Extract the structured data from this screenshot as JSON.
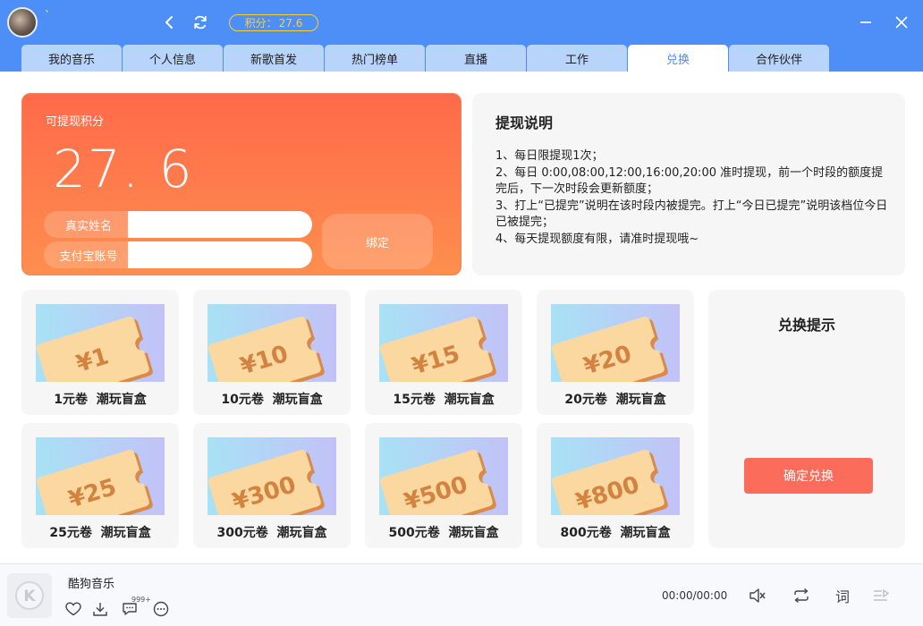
{
  "header": {
    "username": "`",
    "points_label": "积分：",
    "points_value": "27.6",
    "icons": [
      "back-icon",
      "refresh-icon",
      "minimize-icon",
      "close-icon"
    ]
  },
  "tabs": [
    {
      "label": "我的音乐",
      "active": false
    },
    {
      "label": "个人信息",
      "active": false
    },
    {
      "label": "新歌首发",
      "active": false
    },
    {
      "label": "热门榜单",
      "active": false
    },
    {
      "label": "直播",
      "active": false
    },
    {
      "label": "工作",
      "active": false
    },
    {
      "label": "兑换",
      "active": true
    },
    {
      "label": "合作伙伴",
      "active": false
    }
  ],
  "withdraw": {
    "label": "可提现积分",
    "value": "27. 6",
    "real_name_label": "真实姓名",
    "real_name_value": "",
    "alipay_label": "支付宝账号",
    "alipay_value": "",
    "bind_label": "绑定"
  },
  "notes": {
    "title": "提现说明",
    "items": [
      "1、每日限提现1次；",
      "2、每日  0:00,08:00,12:00,16:00,20:00  准时提现，前一个时段的额度提完后，下一次时段会更新额度；",
      "3、打上“已提完”说明在该时段内被提完。打上“今日已提完”说明该档位今日已被提完；",
      "4、每天提现额度有限，请准时提现哦~"
    ]
  },
  "vouchers": [
    {
      "ticket": "¥1",
      "amount": "1元卷",
      "product": "潮玩盲盒"
    },
    {
      "ticket": "¥10",
      "amount": "10元卷",
      "product": "潮玩盲盒"
    },
    {
      "ticket": "¥15",
      "amount": "15元卷",
      "product": "潮玩盲盒"
    },
    {
      "ticket": "¥20",
      "amount": "20元卷",
      "product": "潮玩盲盒"
    },
    {
      "ticket": "¥25",
      "amount": "25元卷",
      "product": "潮玩盲盒"
    },
    {
      "ticket": "¥300",
      "amount": "300元卷",
      "product": "潮玩盲盒"
    },
    {
      "ticket": "¥500",
      "amount": "500元卷",
      "product": "潮玩盲盒"
    },
    {
      "ticket": "¥800",
      "amount": "800元卷",
      "product": "潮玩盲盒"
    }
  ],
  "tip": {
    "title": "兑换提示",
    "confirm_label": "确定兑换"
  },
  "player": {
    "title": "酷狗音乐",
    "comment_count": "999+",
    "time": "00:00/00:00",
    "lyrics_label": "词",
    "colors": {
      "accent": "#4e8ef7",
      "card": "#ff6a4a",
      "confirm": "#fb6c5a"
    }
  }
}
